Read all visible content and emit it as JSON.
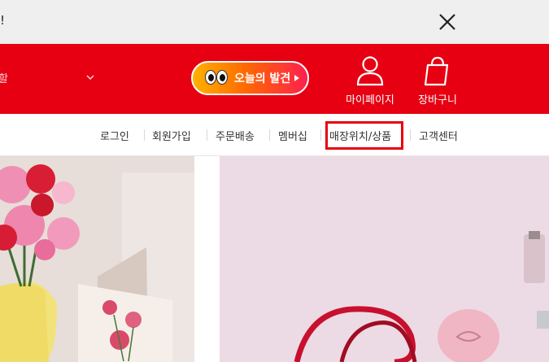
{
  "top_bar": {
    "text": "!"
  },
  "header": {
    "left_fragment": "할",
    "discover_label": "오늘의 발견",
    "mypage_label": "마이페이지",
    "cart_label": "장바구니"
  },
  "nav": {
    "items": [
      {
        "label": "로그인"
      },
      {
        "label": "회원가입"
      },
      {
        "label": "주문배송"
      },
      {
        "label": "멤버십"
      },
      {
        "label": "매장위치/상품"
      },
      {
        "label": "고객센터"
      }
    ]
  },
  "colors": {
    "brand_red": "#e60012",
    "highlight_red": "#e8000e",
    "top_bar_bg": "#efefef"
  },
  "icons": [
    "close-icon",
    "chevron-down-icon",
    "eyes-icon",
    "play-icon",
    "user-icon",
    "shopping-bag-icon",
    "arrow-icon"
  ]
}
